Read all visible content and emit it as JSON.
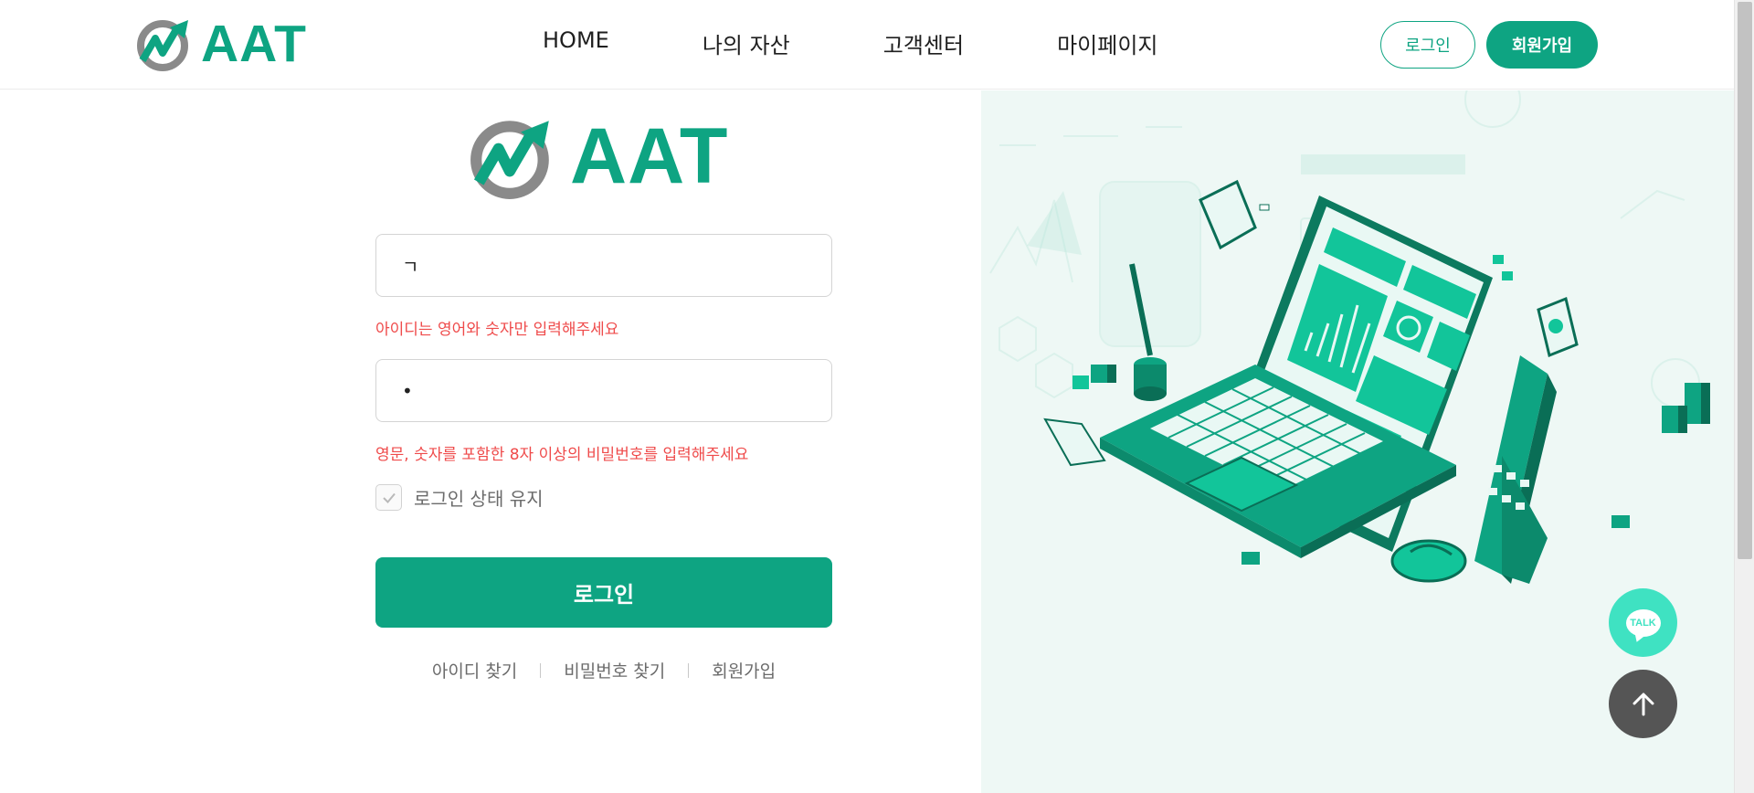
{
  "header": {
    "brand": "AAT",
    "nav": [
      "HOME",
      "나의 자산",
      "고객센터",
      "마이페이지"
    ],
    "login_button": "로그인",
    "join_button": "회원가입"
  },
  "form": {
    "logo_text": "AAT",
    "id_value": "ㄱ",
    "id_error": "아이디는 영어와 숫자만 입력해주세요",
    "password_value": "•",
    "password_error": "영문, 숫자를 포함한 8자 이상의 비밀번호를 입력해주세요",
    "keep_login_label": "로그인 상태 유지",
    "login_button": "로그인",
    "links": [
      "아이디 찾기",
      "비밀번호 찾기",
      "회원가입"
    ]
  },
  "floating": {
    "talk_label": "TALK"
  },
  "colors": {
    "brand": "#0ea482",
    "error": "#ef4b4b",
    "illustration_bg": "#eef8f5",
    "talk": "#3fe2c2",
    "top_button": "#555555"
  },
  "icons": [
    "logo-mark-icon",
    "checkmark-icon",
    "talk-icon",
    "arrow-up-icon"
  ]
}
